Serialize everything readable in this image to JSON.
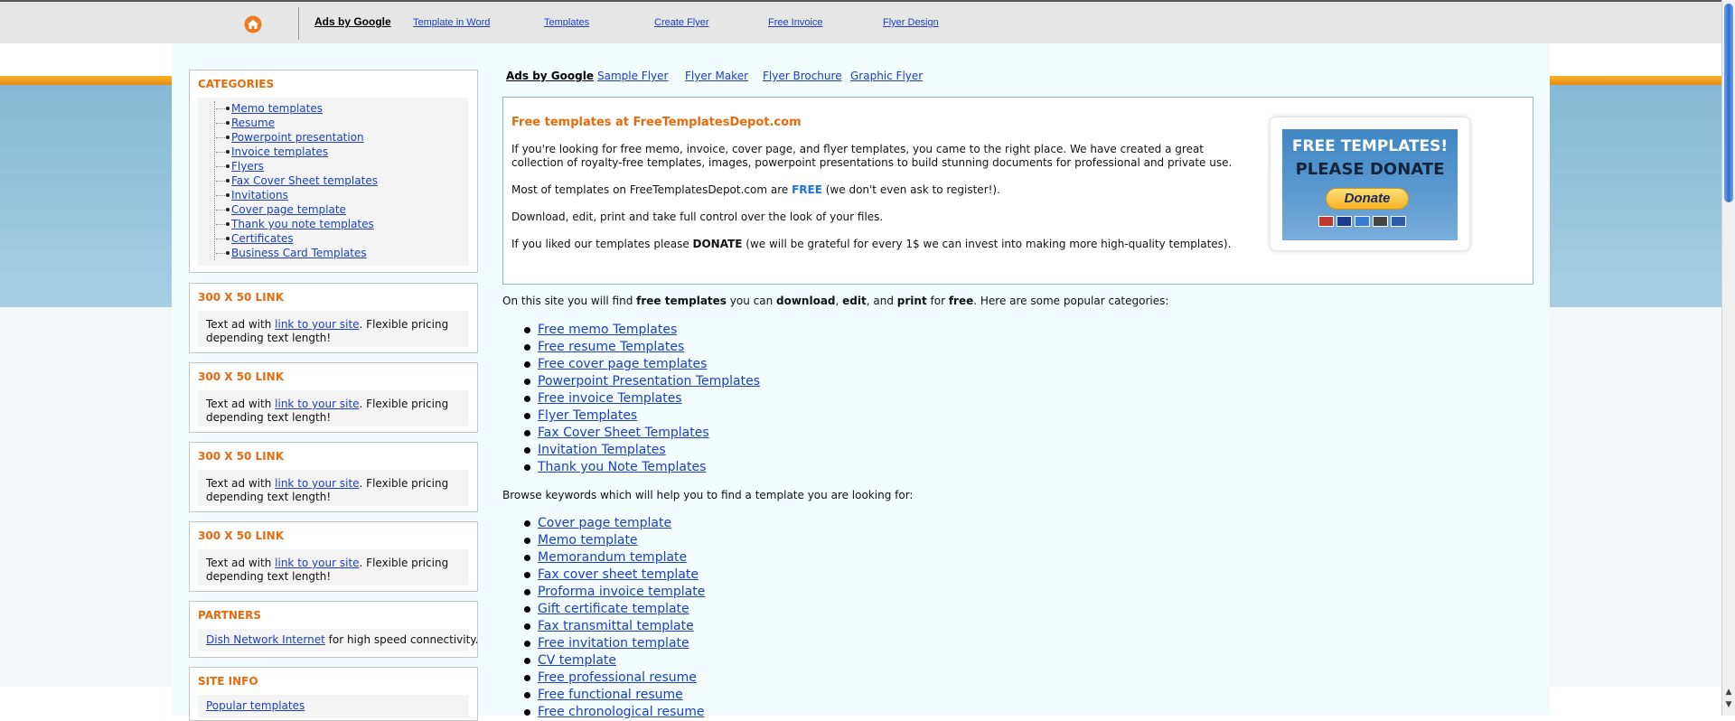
{
  "topnav": {
    "ads_label": "Ads by Google",
    "links": [
      "Template in Word",
      "Templates",
      "Create Flyer",
      "Free Invoice",
      "Flyer Design"
    ],
    "home_icon": "home-icon"
  },
  "subnav": {
    "ads_label": "Ads by Google",
    "links": [
      "Sample Flyer",
      "Flyer Maker",
      "Flyer Brochure",
      "Graphic Flyer"
    ]
  },
  "sidebar": {
    "categories_title": "CATEGORIES",
    "categories": [
      "Memo templates",
      "Resume",
      "Powerpoint presentation",
      "Invoice templates",
      "Flyers",
      "Fax Cover Sheet templates",
      "Invitations",
      "Cover page template",
      "Thank you note templates",
      "Certificates",
      "Business Card Templates"
    ],
    "ads": [
      {
        "title": "300 X 50 LINK",
        "pre": "Text ad with ",
        "link": "link to your site",
        "post": ". Flexible pricing depending text length!"
      },
      {
        "title": "300 X 50 LINK",
        "pre": "Text ad with ",
        "link": "link to your site",
        "post": ". Flexible pricing depending text length!"
      },
      {
        "title": "300 X 50 LINK",
        "pre": "Text ad with ",
        "link": "link to your site",
        "post": ". Flexible pricing depending text length!"
      },
      {
        "title": "300 X 50 LINK",
        "pre": "Text ad with ",
        "link": "link to your site",
        "post": ". Flexible pricing depending text length!"
      }
    ],
    "partners": {
      "title": "PARTNERS",
      "link": "Dish Network Internet",
      "post": " for high speed connectivity."
    },
    "site_info": {
      "title": "SITE INFO",
      "link": "Popular templates"
    }
  },
  "intro": {
    "title": "Free templates at FreeTemplatesDepot.com",
    "p1": "If you're looking for free memo, invoice, cover page, and flyer templates, you came to the right place. We have created a great collection of royalty-free templates, images, powerpoint presentations to build stunning documents for professional and private use.",
    "p2_pre": "Most of templates on FreeTemplatesDepot.com are ",
    "p2_free": "FREE",
    "p2_post": " (we don't even ask to register!).",
    "p3": "Download, edit, print and take full control over the look of your files.",
    "p4_pre": "If you liked our templates please ",
    "p4_donate": "DONATE",
    "p4_post": " (we will be grateful for every 1$ we can invest into making more high-quality templates).",
    "donate_banner": {
      "line1": "FREE TEMPLATES!",
      "line2": "PLEASE DONATE",
      "button": "Donate",
      "card_colors": [
        "#c0392b",
        "#1a3c8f",
        "#3a7bd5",
        "#444444",
        "#2a5caa"
      ]
    }
  },
  "body": {
    "p1": [
      "On this site you will find ",
      "free templates",
      " you can ",
      "download",
      ", ",
      "edit",
      ", and ",
      "print",
      " for ",
      "free",
      ". Here are some popular categories:"
    ],
    "popular": [
      "Free memo Templates",
      "Free resume Templates",
      "Free cover page templates",
      "Powerpoint Presentation Templates",
      "Free invoice Templates",
      "Flyer Templates",
      "Fax Cover Sheet Templates",
      "Invitation Templates",
      "Thank you Note Templates"
    ],
    "p2": "Browse keywords which will help you to find a template you are looking for:",
    "keywords": [
      "Cover page template",
      "Memo template",
      "Memorandum template",
      "Fax cover sheet template",
      "Proforma invoice template",
      "Gift certificate template",
      "Fax transmittal template",
      "Free invitation template",
      "CV template",
      "Free professional resume",
      "Free functional resume",
      "Free chronological resume"
    ]
  },
  "colors": {
    "accent_orange": "#e96a0c",
    "link_blue": "#1a3fc4",
    "free_blue": "#1a73d9"
  }
}
